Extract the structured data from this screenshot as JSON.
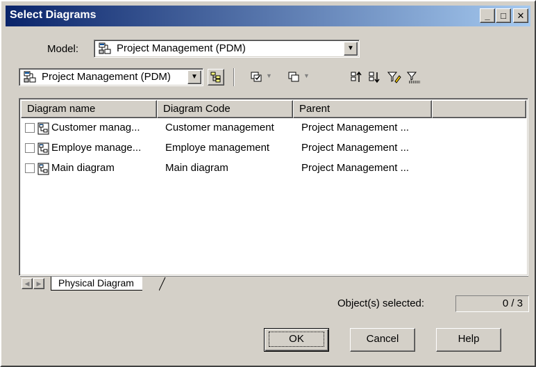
{
  "window": {
    "title": "Select Diagrams",
    "minimize": "_",
    "maximize": "□",
    "close": "✕"
  },
  "model": {
    "label": "Model:",
    "value": "Project Management (PDM)"
  },
  "toolbar": {
    "package_value": "Project Management (PDM)",
    "icons": [
      "include-subpackages-icon",
      "select-all-icon",
      "deselect-all-icon",
      "move-to-top-icon",
      "move-to-bottom-icon",
      "filter-icon",
      "clear-filter-icon"
    ]
  },
  "grid": {
    "columns": [
      "Diagram name",
      "Diagram Code",
      "Parent"
    ],
    "rows": [
      {
        "name": "Customer manag...",
        "code": "Customer management",
        "parent": "Project Management ...",
        "checked": false
      },
      {
        "name": "Employe manage...",
        "code": "Employe management",
        "parent": "Project Management ...",
        "checked": false
      },
      {
        "name": "Main diagram",
        "code": "Main diagram",
        "parent": "Project Management ...",
        "checked": false
      }
    ]
  },
  "tabs": [
    "Physical Diagram"
  ],
  "status": {
    "label": "Object(s) selected:",
    "value": "0 / 3"
  },
  "buttons": {
    "ok": "OK",
    "cancel": "Cancel",
    "help": "Help"
  }
}
